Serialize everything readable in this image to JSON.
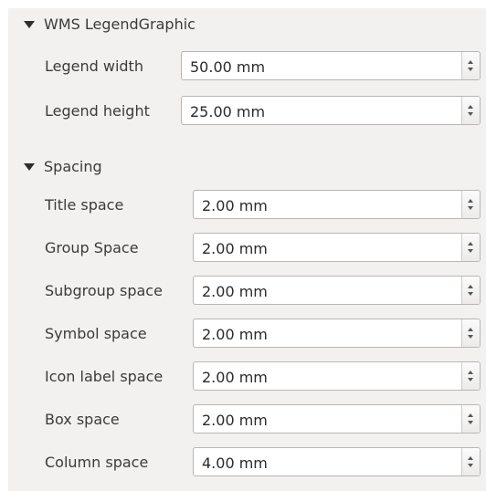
{
  "wms_section": {
    "title": "WMS LegendGraphic",
    "fields": [
      {
        "label": "Legend width",
        "value": "50.00 mm"
      },
      {
        "label": "Legend height",
        "value": "25.00 mm"
      }
    ]
  },
  "spacing_section": {
    "title": "Spacing",
    "fields": [
      {
        "label": "Title space",
        "value": "2.00 mm"
      },
      {
        "label": "Group Space",
        "value": "2.00 mm"
      },
      {
        "label": "Subgroup space",
        "value": "2.00 mm"
      },
      {
        "label": "Symbol space",
        "value": "2.00 mm"
      },
      {
        "label": "Icon label space",
        "value": "2.00 mm"
      },
      {
        "label": "Box space",
        "value": "2.00 mm"
      },
      {
        "label": "Column space",
        "value": "4.00 mm"
      }
    ]
  },
  "icons": {
    "expand": "triangle-down",
    "spin_up": "chevron-up",
    "spin_down": "chevron-down"
  }
}
